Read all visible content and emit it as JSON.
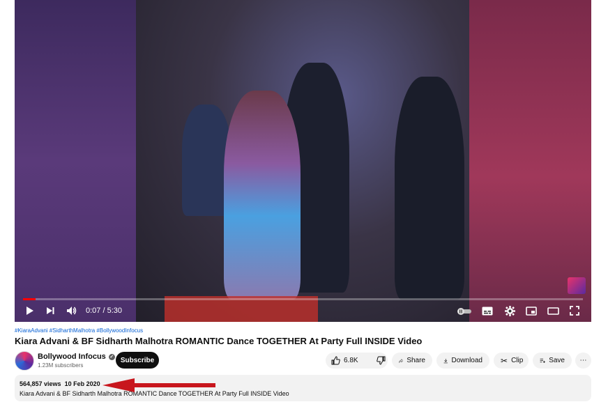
{
  "player": {
    "time_display": "0:07 / 5:30",
    "progress_fraction": 0.022,
    "progress_color": "#ff0000"
  },
  "video": {
    "hashtags": "#KiaraAdvani #SidharthMalhotra #BollywoodInfocus",
    "title": "Kiara Advani & BF Sidharth Malhotra ROMANTIC Dance TOGETHER At Party Full INSIDE Video"
  },
  "channel": {
    "name": "Bollywood Infocus",
    "subscribers": "1.23M subscribers",
    "verified_icon": "check-icon"
  },
  "actions": {
    "subscribe_label": "Subscribe",
    "like_count": "6.8K",
    "share_label": "Share",
    "download_label": "Download",
    "clip_label": "Clip",
    "save_label": "Save",
    "more_label": "⋯"
  },
  "description": {
    "views": "564,857 views",
    "date": "10 Feb 2020",
    "text": "Kiara Advani & BF Sidharth Malhotra ROMANTIC Dance TOGETHER At Party Full INSIDE Video"
  },
  "annotation": {
    "arrow_color": "#c8161d"
  }
}
